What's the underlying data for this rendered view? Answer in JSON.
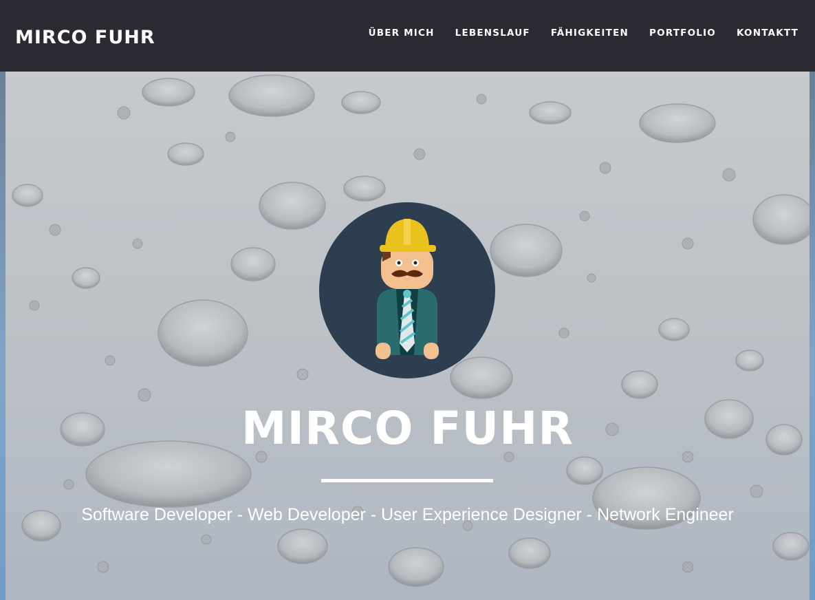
{
  "navbar": {
    "brand": "MIRCO FUHR",
    "items": [
      {
        "label": "ÜBER MICH"
      },
      {
        "label": "LEBENSLAUF"
      },
      {
        "label": "FÄHIGKEITEN"
      },
      {
        "label": "PORTFOLIO"
      },
      {
        "label": "KONTAKTT"
      }
    ]
  },
  "hero": {
    "avatar_icon": "construction-worker-avatar-icon",
    "title": "MIRCO FUHR",
    "subtitle": "Software Developer - Web Developer - User Experience Designer - Network Engineer"
  },
  "colors": {
    "navbar_bg": "#2b2a33",
    "avatar_bg": "#2c3e50",
    "helmet": "#e9c21d",
    "jacket": "#2a6b70",
    "text": "#ffffff"
  }
}
